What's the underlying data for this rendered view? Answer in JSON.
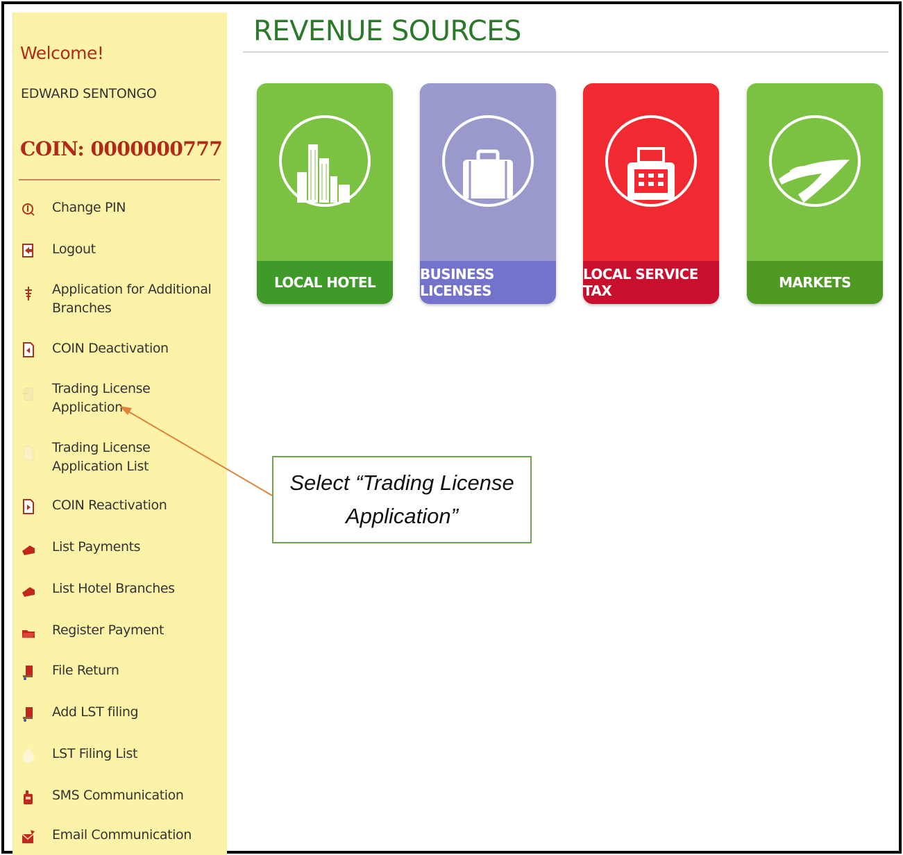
{
  "sidebar": {
    "welcome": "Welcome!",
    "username": "EDWARD SENTONGO",
    "coin": "COIN: 0000000777",
    "items": [
      {
        "label": "Change PIN",
        "icon": "pin-icon"
      },
      {
        "label": "Logout",
        "icon": "logout-icon"
      },
      {
        "label": "Application for Additional Branches",
        "icon": "branches-icon"
      },
      {
        "label": "COIN Deactivation",
        "icon": "deactivate-icon"
      },
      {
        "label": "Trading License Application",
        "icon": "license-icon"
      },
      {
        "label": "Trading License Application List",
        "icon": "document-icon"
      },
      {
        "label": "COIN Reactivation",
        "icon": "reactivate-icon"
      },
      {
        "label": "List Payments",
        "icon": "payments-icon"
      },
      {
        "label": "List Hotel Branches",
        "icon": "hotel-branches-icon"
      },
      {
        "label": "Register Payment",
        "icon": "register-payment-icon"
      },
      {
        "label": "File Return",
        "icon": "file-return-icon"
      },
      {
        "label": "Add LST filing",
        "icon": "add-lst-icon"
      },
      {
        "label": "LST Filing List",
        "icon": "lst-list-icon"
      },
      {
        "label": "SMS Communication",
        "icon": "sms-icon"
      },
      {
        "label": "Email Communication",
        "icon": "email-icon"
      }
    ]
  },
  "main": {
    "title": "REVENUE SOURCES",
    "tiles": [
      {
        "label": "LOCAL HOTEL",
        "icon": "buildings-icon",
        "color": "#7cc242",
        "band": "#3f9a2a"
      },
      {
        "label": "BUSINESS LICENSES",
        "icon": "briefcase-icon",
        "color": "#9999cc",
        "band": "#7373cc"
      },
      {
        "label": "LOCAL SERVICE TAX",
        "icon": "cash-register-icon",
        "color": "#f02a30",
        "band": "#c8102e"
      },
      {
        "label": "MARKETS",
        "icon": "produce-icon",
        "color": "#7cc242",
        "band": "#4e9a22"
      }
    ]
  },
  "callout": {
    "text": "Select “Trading License Application”",
    "border_color": "#6aa84f",
    "arrow_color": "#e0803a"
  }
}
